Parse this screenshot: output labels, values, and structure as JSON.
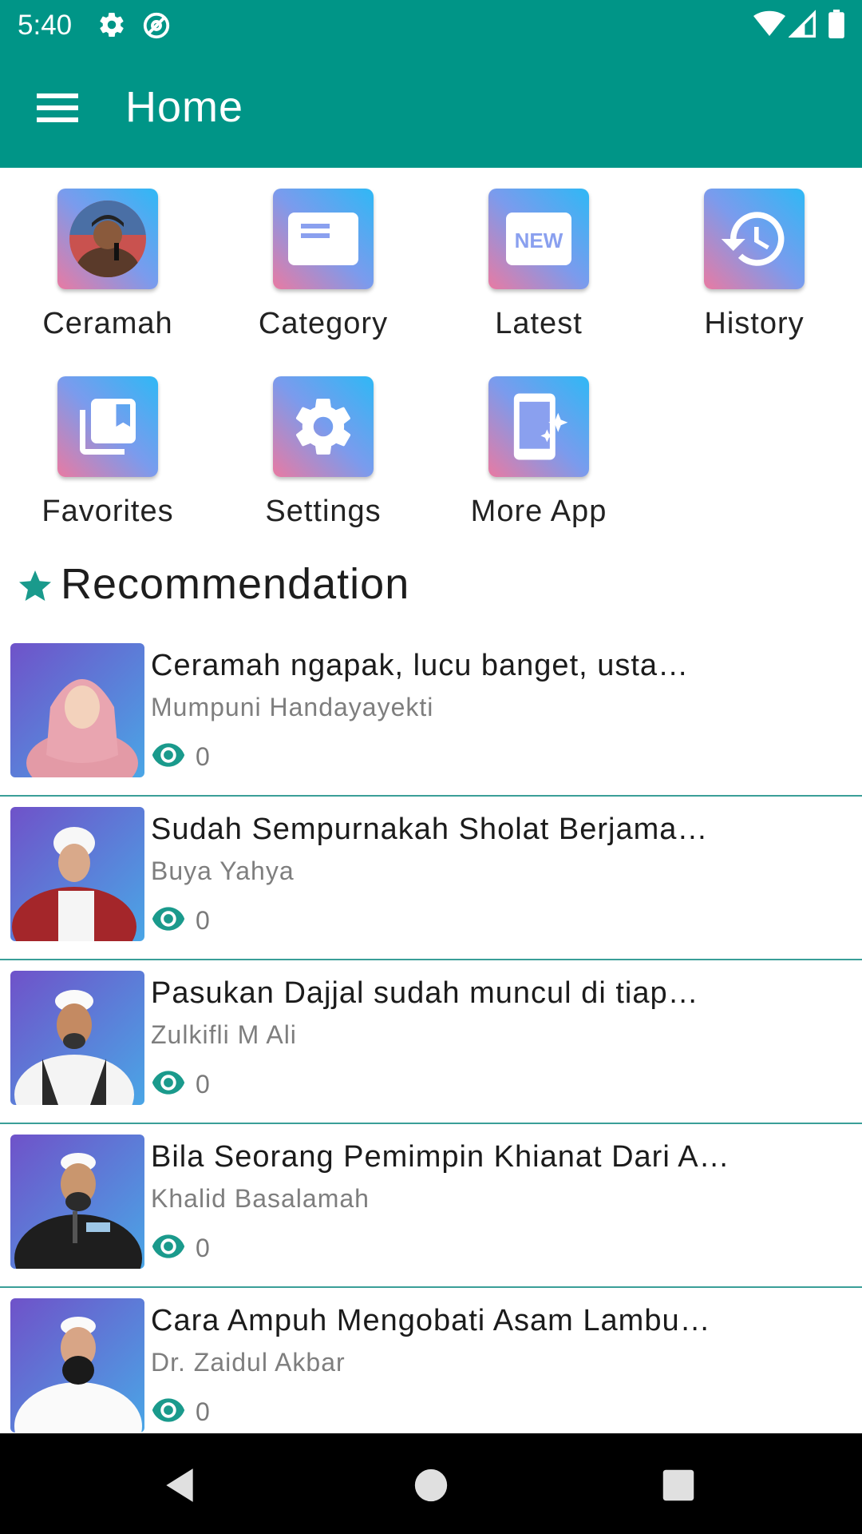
{
  "status_bar": {
    "time": "5:40",
    "icons": [
      "gear-icon",
      "at-icon",
      "wifi-icon",
      "signal-icon",
      "battery-icon"
    ]
  },
  "app_bar": {
    "title": "Home",
    "menu_icon": "hamburger-menu-icon"
  },
  "menu_grid": [
    {
      "label": "Ceramah",
      "icon": "ceramah-photo-icon"
    },
    {
      "label": "Category",
      "icon": "category-icon"
    },
    {
      "label": "Latest",
      "icon": "new-icon"
    },
    {
      "label": "History",
      "icon": "history-icon"
    },
    {
      "label": "Favorites",
      "icon": "bookmark-icon"
    },
    {
      "label": "Settings",
      "icon": "gear-icon"
    },
    {
      "label": "More App",
      "icon": "more-app-icon"
    }
  ],
  "section": {
    "title": "Recommendation",
    "icon": "star-icon"
  },
  "recommendations": [
    {
      "title": "Ceramah ngapak,  lucu banget,  usta…",
      "author": "Mumpuni Handayayekti",
      "views": "0"
    },
    {
      "title": "Sudah Sempurnakah Sholat Berjama…",
      "author": "Buya Yahya",
      "views": "0"
    },
    {
      "title": "Pasukan Dajjal sudah muncul di tiap…",
      "author": "Zulkifli M Ali",
      "views": "0"
    },
    {
      "title": "Bila Seorang Pemimpin Khianat Dari A…",
      "author": "Khalid Basalamah",
      "views": "0"
    },
    {
      "title": "Cara Ampuh Mengobati Asam Lambu…",
      "author": "Dr. Zaidul Akbar",
      "views": "0"
    }
  ],
  "colors": {
    "primary": "#009587",
    "accent": "#3a9f98",
    "eye": "#1a9a8c"
  },
  "nav_bar": {
    "buttons": [
      "back-icon",
      "home-icon",
      "recents-icon"
    ]
  }
}
